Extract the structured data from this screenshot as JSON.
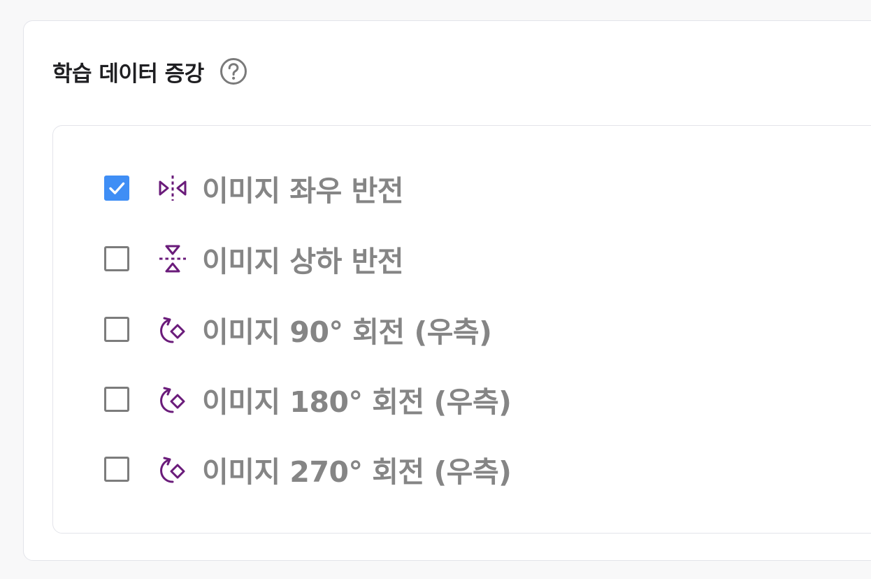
{
  "section": {
    "title": "학습 데이터 증강",
    "help_icon": "question-circle-icon"
  },
  "colors": {
    "checkbox_checked": "#3f8ef5",
    "checkbox_border": "#7c7c7c",
    "icon_accent": "#6a1b7a",
    "label_text": "#858585",
    "title_text": "#1f1f22"
  },
  "options": [
    {
      "label": "이미지 좌우 반전",
      "checked": true,
      "icon": "flip-horizontal-icon"
    },
    {
      "label": "이미지 상하 반전",
      "checked": false,
      "icon": "flip-vertical-icon"
    },
    {
      "label": "이미지 90° 회전 (우측)",
      "checked": false,
      "icon": "rotate-right-icon"
    },
    {
      "label": "이미지 180° 회전 (우측)",
      "checked": false,
      "icon": "rotate-right-icon"
    },
    {
      "label": "이미지 270° 회전 (우측)",
      "checked": false,
      "icon": "rotate-right-icon"
    }
  ]
}
